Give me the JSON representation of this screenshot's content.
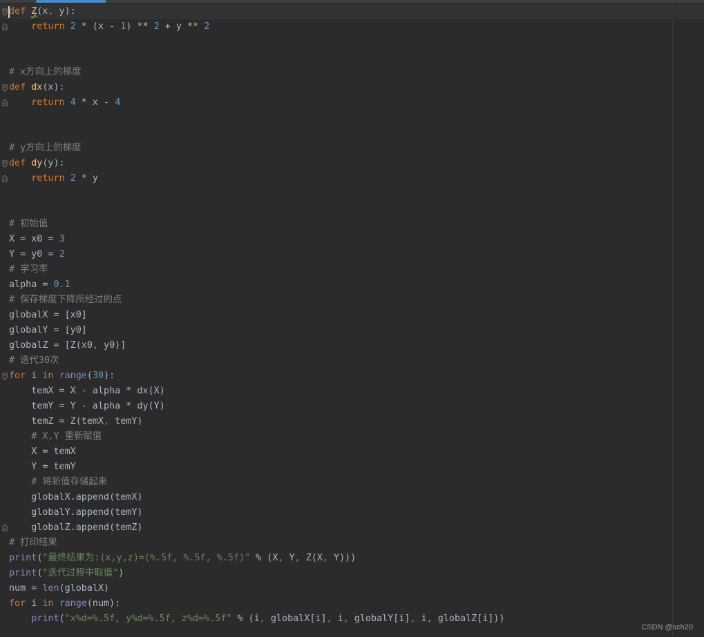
{
  "editor": {
    "lines": [
      {
        "tokens": [
          {
            "t": "def",
            "c": "kw"
          },
          {
            "t": " "
          },
          {
            "t": "Z",
            "c": "fn warn"
          },
          {
            "t": "(x"
          },
          {
            "t": ",",
            "c": "kw"
          },
          {
            "t": " y):"
          }
        ]
      },
      {
        "tokens": [
          {
            "t": "    "
          },
          {
            "t": "return",
            "c": "kw"
          },
          {
            "t": " "
          },
          {
            "t": "2",
            "c": "num"
          },
          {
            "t": " * (x - "
          },
          {
            "t": "1",
            "c": "num"
          },
          {
            "t": ") ** "
          },
          {
            "t": "2",
            "c": "num"
          },
          {
            "t": " + y ** "
          },
          {
            "t": "2",
            "c": "num"
          }
        ]
      },
      {
        "tokens": []
      },
      {
        "tokens": []
      },
      {
        "tokens": [
          {
            "t": "# x方向上的梯度",
            "c": "cmt"
          }
        ]
      },
      {
        "tokens": [
          {
            "t": "def",
            "c": "kw"
          },
          {
            "t": " "
          },
          {
            "t": "dx",
            "c": "fn"
          },
          {
            "t": "(x):"
          }
        ]
      },
      {
        "tokens": [
          {
            "t": "    "
          },
          {
            "t": "return",
            "c": "kw"
          },
          {
            "t": " "
          },
          {
            "t": "4",
            "c": "num"
          },
          {
            "t": " * x - "
          },
          {
            "t": "4",
            "c": "num"
          }
        ]
      },
      {
        "tokens": []
      },
      {
        "tokens": []
      },
      {
        "tokens": [
          {
            "t": "# y方向上的梯度",
            "c": "cmt"
          }
        ]
      },
      {
        "tokens": [
          {
            "t": "def",
            "c": "kw"
          },
          {
            "t": " "
          },
          {
            "t": "dy",
            "c": "fn"
          },
          {
            "t": "(y):"
          }
        ]
      },
      {
        "tokens": [
          {
            "t": "    "
          },
          {
            "t": "return",
            "c": "kw"
          },
          {
            "t": " "
          },
          {
            "t": "2",
            "c": "num"
          },
          {
            "t": " * y"
          }
        ]
      },
      {
        "tokens": []
      },
      {
        "tokens": []
      },
      {
        "tokens": [
          {
            "t": "# 初始值",
            "c": "cmt"
          }
        ]
      },
      {
        "tokens": [
          {
            "t": "X = x0 = "
          },
          {
            "t": "3",
            "c": "num"
          }
        ]
      },
      {
        "tokens": [
          {
            "t": "Y = y0 = "
          },
          {
            "t": "2",
            "c": "num"
          }
        ]
      },
      {
        "tokens": [
          {
            "t": "# 学习率",
            "c": "cmt"
          }
        ]
      },
      {
        "tokens": [
          {
            "t": "alpha = "
          },
          {
            "t": "0.1",
            "c": "num"
          }
        ]
      },
      {
        "tokens": [
          {
            "t": "# 保存梯度下降所经过的点",
            "c": "cmt"
          }
        ]
      },
      {
        "tokens": [
          {
            "t": "globalX = [x0]"
          }
        ]
      },
      {
        "tokens": [
          {
            "t": "globalY = [y0]"
          }
        ]
      },
      {
        "tokens": [
          {
            "t": "globalZ = [Z(x0"
          },
          {
            "t": ",",
            "c": "kw"
          },
          {
            "t": " y0)]"
          }
        ]
      },
      {
        "tokens": [
          {
            "t": "# 迭代30次",
            "c": "cmt"
          }
        ]
      },
      {
        "tokens": [
          {
            "t": "for",
            "c": "kw"
          },
          {
            "t": " i "
          },
          {
            "t": "in",
            "c": "kw"
          },
          {
            "t": " "
          },
          {
            "t": "range",
            "c": "bi"
          },
          {
            "t": "("
          },
          {
            "t": "30",
            "c": "num"
          },
          {
            "t": "):"
          }
        ]
      },
      {
        "tokens": [
          {
            "t": "    temX = X - alpha * dx(X)"
          }
        ]
      },
      {
        "tokens": [
          {
            "t": "    temY = Y - alpha * dy(Y)"
          }
        ]
      },
      {
        "tokens": [
          {
            "t": "    temZ = Z(temX"
          },
          {
            "t": ",",
            "c": "kw"
          },
          {
            "t": " temY)"
          }
        ]
      },
      {
        "tokens": [
          {
            "t": "    "
          },
          {
            "t": "# X,Y 重新赋值",
            "c": "cmt"
          }
        ]
      },
      {
        "tokens": [
          {
            "t": "    X = temX"
          }
        ]
      },
      {
        "tokens": [
          {
            "t": "    Y = temY"
          }
        ]
      },
      {
        "tokens": [
          {
            "t": "    "
          },
          {
            "t": "# 将新值存储起来",
            "c": "cmt"
          }
        ]
      },
      {
        "tokens": [
          {
            "t": "    globalX.append(temX)"
          }
        ]
      },
      {
        "tokens": [
          {
            "t": "    globalY.append(temY)"
          }
        ]
      },
      {
        "tokens": [
          {
            "t": "    globalZ.append(temZ)"
          }
        ]
      },
      {
        "tokens": [
          {
            "t": "# 打印结果",
            "c": "cmt"
          }
        ]
      },
      {
        "tokens": [
          {
            "t": "print",
            "c": "bi"
          },
          {
            "t": "("
          },
          {
            "t": "\"最终结果为:(x,y,z)=(%.5f, %.5f, %.5f)\"",
            "c": "str"
          },
          {
            "t": " % (X"
          },
          {
            "t": ",",
            "c": "kw"
          },
          {
            "t": " Y"
          },
          {
            "t": ",",
            "c": "kw"
          },
          {
            "t": " Z(X"
          },
          {
            "t": ",",
            "c": "kw"
          },
          {
            "t": " Y)))"
          }
        ]
      },
      {
        "tokens": [
          {
            "t": "print",
            "c": "bi"
          },
          {
            "t": "("
          },
          {
            "t": "\"迭代过程中取值\"",
            "c": "str"
          },
          {
            "t": ")"
          }
        ]
      },
      {
        "tokens": [
          {
            "t": "num = "
          },
          {
            "t": "len",
            "c": "bi"
          },
          {
            "t": "(globalX)"
          }
        ]
      },
      {
        "tokens": [
          {
            "t": "for",
            "c": "kw"
          },
          {
            "t": " i "
          },
          {
            "t": "in",
            "c": "kw"
          },
          {
            "t": " "
          },
          {
            "t": "range",
            "c": "bi"
          },
          {
            "t": "(num):"
          }
        ]
      },
      {
        "tokens": [
          {
            "t": "    "
          },
          {
            "t": "print",
            "c": "bi"
          },
          {
            "t": "("
          },
          {
            "t": "\"x%d=%.5f, y%d=%.5f, z%d=%.5f\"",
            "c": "str"
          },
          {
            "t": " % (i"
          },
          {
            "t": ",",
            "c": "kw"
          },
          {
            "t": " globalX[i]"
          },
          {
            "t": ",",
            "c": "kw"
          },
          {
            "t": " i"
          },
          {
            "t": ",",
            "c": "kw"
          },
          {
            "t": " globalY[i]"
          },
          {
            "t": ",",
            "c": "kw"
          },
          {
            "t": " i"
          },
          {
            "t": ",",
            "c": "kw"
          },
          {
            "t": " globalZ[i]))"
          }
        ]
      }
    ]
  },
  "watermark": "CSDN @sch20",
  "colors": {
    "background": "#2b2b2b",
    "keyword": "#cc7832",
    "function": "#ffc66d",
    "number": "#6897bb",
    "comment": "#808080",
    "string": "#6a8759",
    "builtin": "#8888c6",
    "text": "#a9b7c6"
  }
}
